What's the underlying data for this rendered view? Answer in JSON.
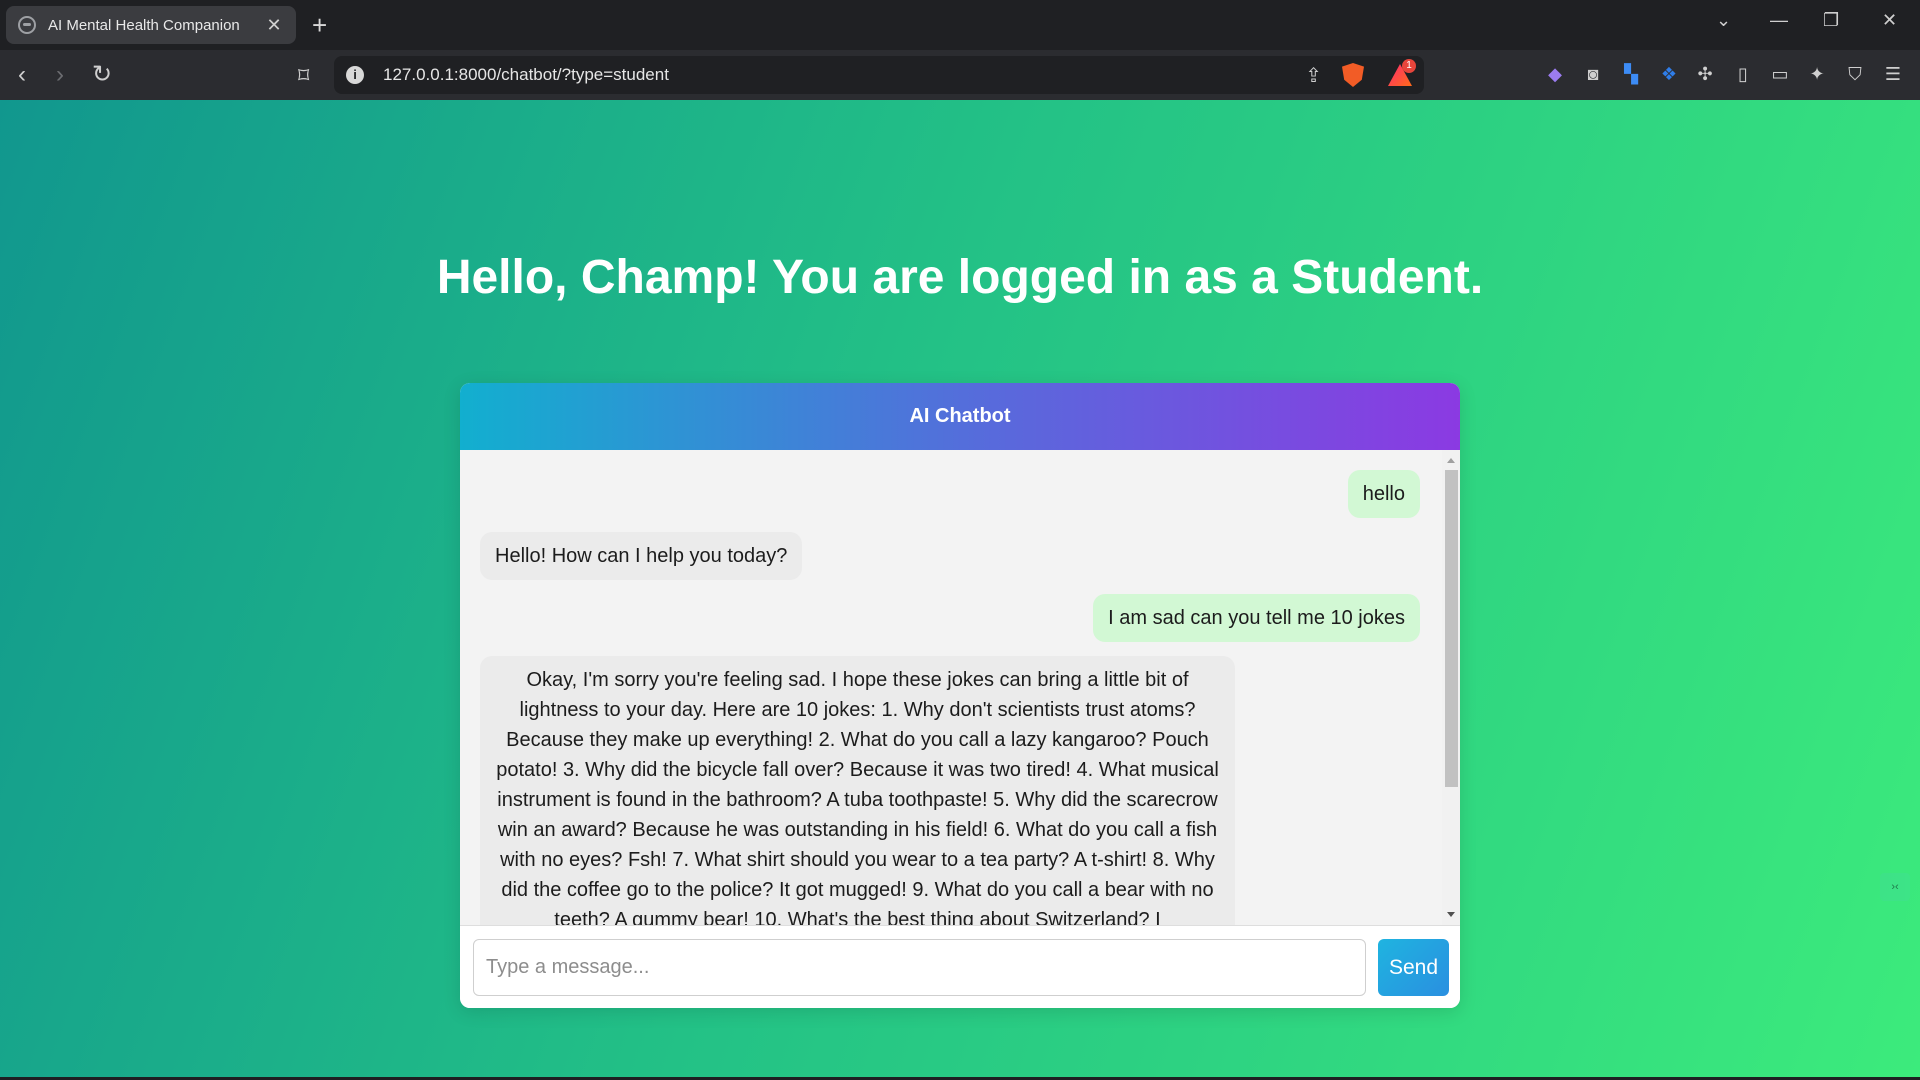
{
  "browser": {
    "tab_title": "AI Mental Health Companion",
    "url": "127.0.0.1:8000/chatbot/?type=student",
    "notification_count": "1",
    "icons": [
      "globe-icon",
      "close-icon",
      "plus-icon",
      "chevron-down-icon",
      "minimize-icon",
      "restore-icon",
      "window-close-icon",
      "back-icon",
      "forward-icon",
      "reload-icon",
      "bookmark-icon",
      "info-icon",
      "share-icon",
      "brave-shield-icon",
      "brave-rewards-icon",
      "extension-diamond-icon",
      "camera-icon",
      "extension-blue-icon",
      "extension-arrow-icon",
      "puzzle-icon",
      "sidebar-icon",
      "wallet-icon",
      "leo-icon",
      "vpn-icon",
      "menu-icon"
    ]
  },
  "page": {
    "heading": "Hello, Champ! You are logged in as a Student."
  },
  "chat": {
    "title": "AI Chatbot",
    "messages": [
      {
        "sender": "user",
        "text": "hello"
      },
      {
        "sender": "bot",
        "text": "Hello! How can I help you today?"
      },
      {
        "sender": "user",
        "text": "I am sad can you tell me 10 jokes"
      },
      {
        "sender": "bot",
        "text": "Okay, I'm sorry you're feeling sad. I hope these jokes can bring a little bit of lightness to your day. Here are 10 jokes: 1. Why don't scientists trust atoms? Because they make up everything! 2. What do you call a lazy kangaroo? Pouch potato! 3. Why did the bicycle fall over? Because it was two tired! 4. What musical instrument is found in the bathroom? A tuba toothpaste! 5. Why did the scarecrow win an award? Because he was outstanding in his field! 6. What do you call a fish with no eyes? Fsh! 7. What shirt should you wear to a tea party? A t-shirt! 8. Why did the coffee go to the police? It got mugged! 9. What do you call a bear with no teeth? A gummy bear! 10. What's the best thing about Switzerland? I"
      }
    ],
    "input_placeholder": "Type a message...",
    "send_label": "Send"
  },
  "colors": {
    "page_gradient_start": "#11978e",
    "page_gradient_end": "#3ceb7c",
    "header_gradient_start": "#12afcf",
    "header_gradient_end": "#8b3ae2",
    "user_bubble": "#d2f8d4",
    "bot_bubble": "#ebebeb",
    "send_button": "#1fb4e0"
  }
}
